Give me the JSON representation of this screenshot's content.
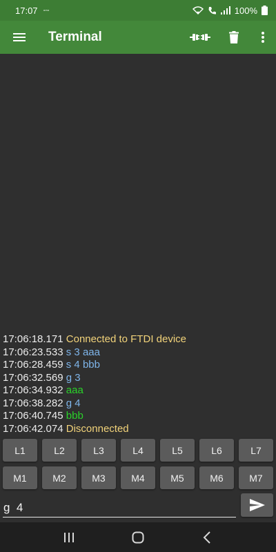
{
  "status_bar": {
    "time": "17:07",
    "sub_indicator": "-·-",
    "battery": "100%"
  },
  "toolbar": {
    "title": "Terminal",
    "icons": [
      "menu-icon",
      "connect-icon",
      "delete-icon",
      "more-vert-icon"
    ]
  },
  "log": [
    {
      "time": "17:06:18.171",
      "message": "Connected to FTDI device",
      "kind": "status"
    },
    {
      "time": "17:06:23.533",
      "message": "s 3 aaa",
      "kind": "sent"
    },
    {
      "time": "17:06:28.459",
      "message": "s 4 bbb",
      "kind": "sent"
    },
    {
      "time": "17:06:32.569",
      "message": "g 3",
      "kind": "sent"
    },
    {
      "time": "17:06:34.932",
      "message": "aaa",
      "kind": "recv"
    },
    {
      "time": "17:06:38.282",
      "message": "g 4",
      "kind": "sent"
    },
    {
      "time": "17:06:40.745",
      "message": "bbb",
      "kind": "recv"
    },
    {
      "time": "17:06:42.074",
      "message": "Disconnected",
      "kind": "status"
    }
  ],
  "colors": {
    "status": "#f2d37a",
    "sent": "#7fb5ea",
    "recv": "#2ad22a",
    "toolbar": "#43883a"
  },
  "macros": {
    "row_l": [
      "L1",
      "L2",
      "L3",
      "L4",
      "L5",
      "L6",
      "L7"
    ],
    "row_m": [
      "M1",
      "M2",
      "M3",
      "M4",
      "M5",
      "M6",
      "M7"
    ]
  },
  "input": {
    "value": "g  4"
  }
}
